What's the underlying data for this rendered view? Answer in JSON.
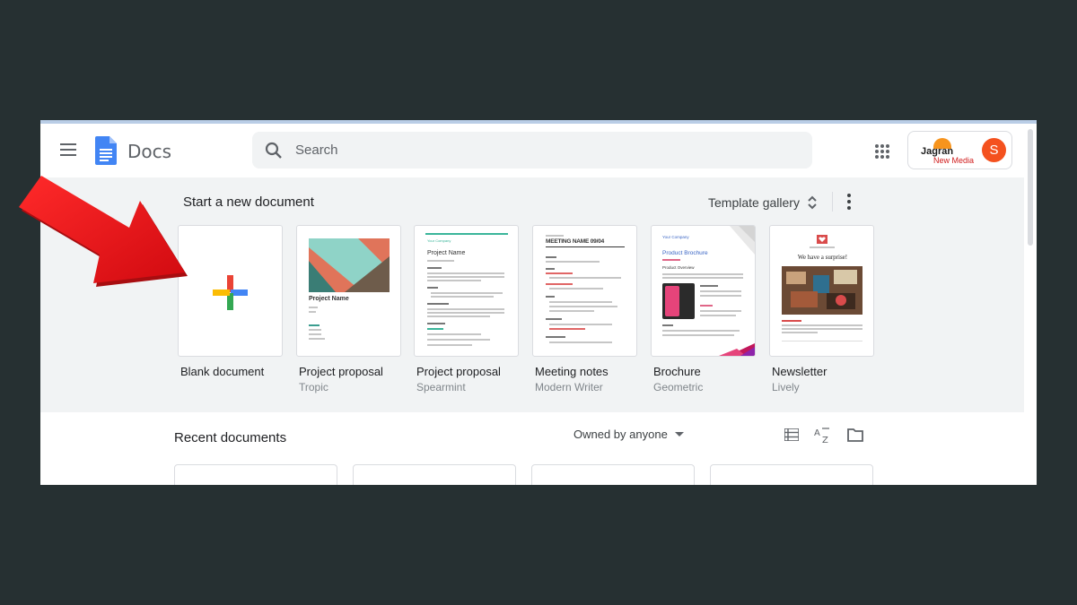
{
  "header": {
    "app_title": "Docs",
    "search_placeholder": "Search",
    "brand": {
      "line1": "Jagran",
      "line2": "New Media"
    },
    "avatar_initial": "S"
  },
  "templates": {
    "section_title": "Start a new document",
    "gallery_label": "Template gallery",
    "items": [
      {
        "name": "Blank document",
        "subtitle": ""
      },
      {
        "name": "Project proposal",
        "subtitle": "Tropic"
      },
      {
        "name": "Project proposal",
        "subtitle": "Spearmint"
      },
      {
        "name": "Meeting notes",
        "subtitle": "Modern Writer"
      },
      {
        "name": "Brochure",
        "subtitle": "Geometric"
      },
      {
        "name": "Newsletter",
        "subtitle": "Lively"
      }
    ],
    "thumb_text": {
      "tropic_title": "Project Name",
      "spearmint_company": "Your Company",
      "spearmint_title": "Project Name",
      "meeting_header": "MEETING NAME 09/04",
      "brochure_company": "Your Company",
      "brochure_title": "Product Brochure",
      "brochure_overview": "Product Overview",
      "newsletter_headline": "We have a surprise!"
    }
  },
  "recent": {
    "title": "Recent documents",
    "owner_filter": "Owned by anyone"
  },
  "colors": {
    "accent_red_arrow": "#e8141a",
    "avatar": "#f4511e",
    "docs_blue": "#4285f4"
  },
  "icons": [
    "menu-icon",
    "docs-logo-icon",
    "search-icon",
    "apps-icon",
    "unfold-icon",
    "more-vert-icon",
    "plus-icon",
    "list-view-icon",
    "sort-az-icon",
    "folder-icon",
    "arrow-pointer"
  ]
}
